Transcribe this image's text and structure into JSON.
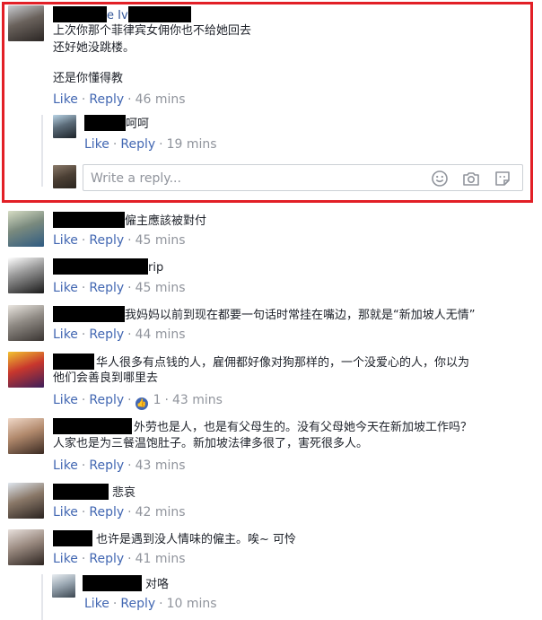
{
  "actions": {
    "like": "Like",
    "reply": "Reply",
    "sep": "·"
  },
  "reply_box": {
    "placeholder": "Write a reply..."
  },
  "comments": [
    {
      "name_suffix": "e Iv",
      "lines": [
        "上次你那个菲律宾女佣你也不给她回去",
        "还好她没跳楼。",
        "还是你懂得教"
      ],
      "time": "46 mins"
    },
    {
      "text": "呵呵",
      "time": "19 mins"
    },
    {
      "text": "僱主應該被對付",
      "time": "45 mins"
    },
    {
      "text": "rip",
      "time": "45 mins"
    },
    {
      "text": "我妈妈以前到现在都要一句话时常挂在嘴边，那就是“新加坡人无情”",
      "time": "44 mins"
    },
    {
      "lines": [
        "华人很多有点钱的人，雇佣都好像对狗那样的，一个没爱心的人，你以为",
        "他们会善良到哪里去"
      ],
      "likes": "1",
      "time": "43 mins"
    },
    {
      "lines": [
        "外劳也是人，也是有父母生的。没有父母她今天在新加坡工作吗？",
        "人家也是为三餐温饱肚子。新加坡法律多很了，害死很多人。"
      ],
      "time": "43 mins"
    },
    {
      "text": "悲哀",
      "time": "42 mins"
    },
    {
      "text": "也许是遇到没人情味的僱主。唉~ 可怜",
      "time": "41 mins"
    },
    {
      "text": "对咯",
      "time": "10 mins"
    }
  ],
  "colors": {
    "link": "#4267b2",
    "meta": "#90949c",
    "highlight": "#e21f26"
  }
}
